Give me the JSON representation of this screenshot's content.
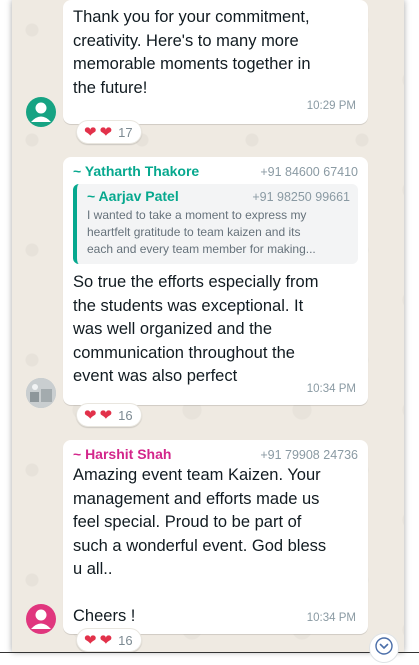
{
  "colors": {
    "chat_background": "#efeae2",
    "bubble": "#ffffff",
    "sender_yatharth": "#06a88e",
    "sender_aarjav": "#06a88e",
    "sender_harshit": "#d3268b",
    "heart": "#e2314a",
    "avatar_default": "#16a383",
    "avatar_pink": "#e0367e"
  },
  "messages": [
    {
      "text": "Thank you for your commitment, creativity. Here's to many more memorable moments together in the future!",
      "lines": [
        "Thank you for your commitment,",
        "creativity. Here's to many more",
        "memorable moments together in",
        "the future!"
      ],
      "time": "10:29 PM",
      "reaction_count": "17",
      "avatar_icon": "default-person-icon"
    },
    {
      "sender": "~ Yatharth Thakore",
      "phone": "+91 84600 67410",
      "quote": {
        "sender": "~ Aarjav Patel",
        "phone": "+91 98250 99661",
        "lines": [
          "I wanted to take a moment to express my",
          "heartfelt gratitude to team kaizen and its",
          "each and every team member for making..."
        ]
      },
      "lines": [
        "So true the efforts especially from",
        "the students was exceptional. It",
        "was well organized and the",
        "communication throughout the",
        "event was also perfect"
      ],
      "time": "10:34 PM",
      "reaction_count": "16",
      "avatar_icon": "photo-avatar-icon"
    },
    {
      "sender": "~ Harshit Shah",
      "phone": "+91 79908 24736",
      "lines": [
        "Amazing event team Kaizen. Your",
        "management and efforts made us",
        "feel special. Proud to be part of",
        "such a wonderful event. God bless",
        "u all..",
        "",
        "Cheers !"
      ],
      "time": "10:34 PM",
      "reaction_count": "16",
      "avatar_icon": "default-person-icon"
    }
  ],
  "scroll_button_icon": "chevron-down-icon"
}
